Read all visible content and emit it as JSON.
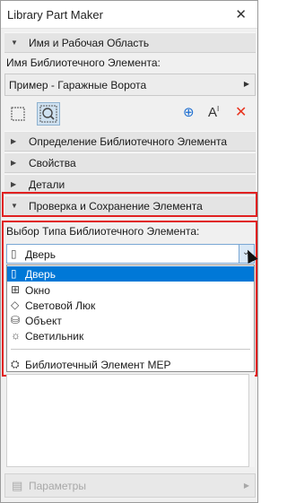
{
  "window": {
    "title": "Library Part Maker",
    "close": "✕"
  },
  "sections": {
    "name_area": "Имя и Рабочая Область",
    "definition": "Определение Библиотечного Элемента",
    "properties": "Свойства",
    "details": "Детали",
    "check_save": "Проверка и Сохранение Элемента"
  },
  "name_field": {
    "label": "Имя Библиотечного Элемента:",
    "value": "Пример - Гаражные Ворота"
  },
  "type_field": {
    "label": "Выбор Типа Библиотечного Элемента:",
    "selected": "Дверь",
    "options": [
      {
        "label": "Дверь",
        "icon": "door-icon",
        "glyph": "▯"
      },
      {
        "label": "Окно",
        "icon": "window-icon",
        "glyph": "⊞"
      },
      {
        "label": "Световой Люк",
        "icon": "skylight-icon",
        "glyph": "◇"
      },
      {
        "label": "Объект",
        "icon": "object-icon",
        "glyph": "⛁"
      },
      {
        "label": "Светильник",
        "icon": "lamp-icon",
        "glyph": "☼"
      },
      {
        "label": "Библиотечный Элемент MEP",
        "icon": "mep-icon",
        "glyph": "⛭"
      }
    ]
  },
  "toolbar": {
    "add": "⊕",
    "text": "A",
    "remove": "✕"
  },
  "params": {
    "label": "Параметры"
  },
  "colors": {
    "highlight": "#0078d7",
    "red_frame": "#e02020",
    "remove": "#e8341f",
    "add": "#1f6fd1"
  }
}
